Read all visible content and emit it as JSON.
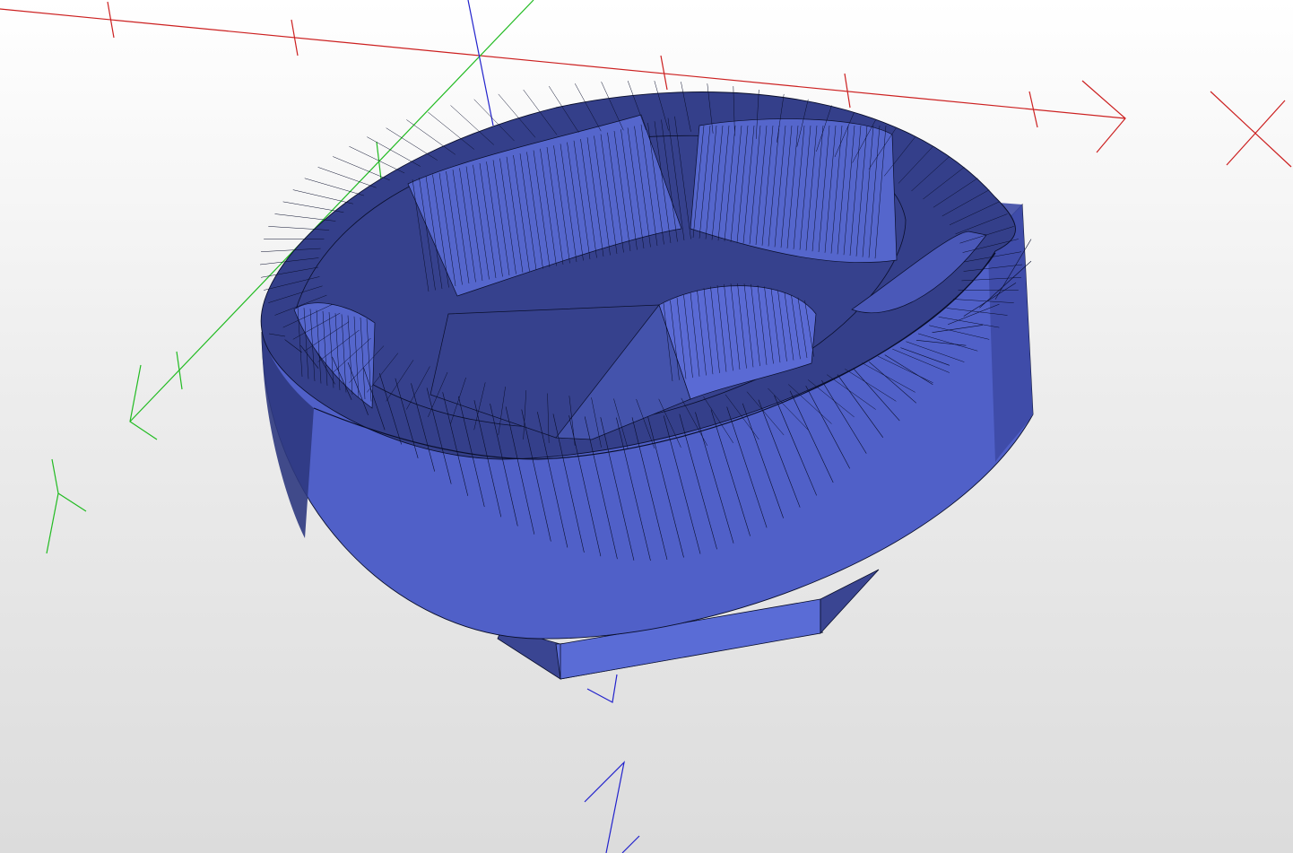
{
  "viewport": {
    "background_top": "#ffffff",
    "background_bottom": "#dcdcdc"
  },
  "model": {
    "fill_light": "#5b6bd0",
    "fill_mid": "#4a57b4",
    "fill_dark": "#333d85",
    "edge_color": "#0a0f2c"
  },
  "axes": {
    "x": {
      "label": "X",
      "color": "#cc2020"
    },
    "y": {
      "label": "Y",
      "color": "#22bb22"
    },
    "z": {
      "label": "Z",
      "color": "#2222cc"
    }
  }
}
